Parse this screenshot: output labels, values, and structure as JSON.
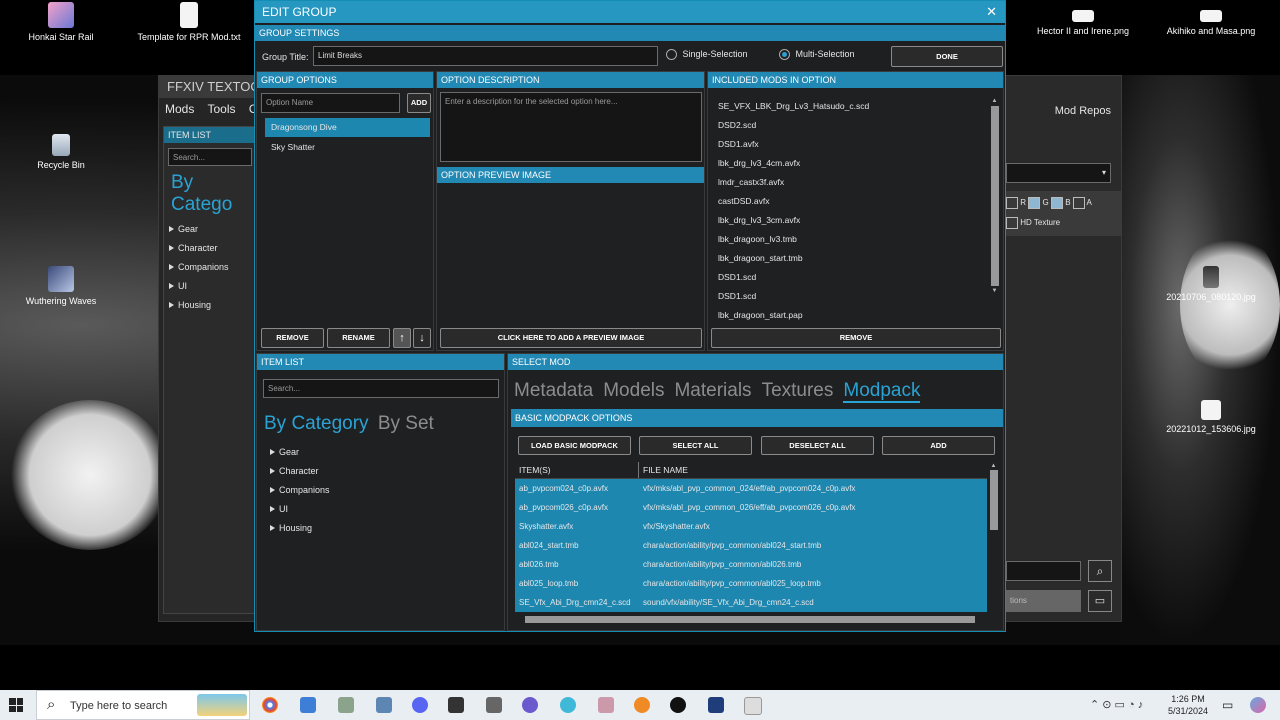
{
  "desktop": {
    "icons": [
      {
        "label": "Honkai Star Rail"
      },
      {
        "label": "Template for RPR Mod.txt"
      },
      {
        "label": "Hector II and Irene.png"
      },
      {
        "label": "Akihiko and Masa.png"
      },
      {
        "label": "Recycle Bin"
      },
      {
        "label": "Wuthering Waves"
      },
      {
        "label": "20210706_080120.jpg"
      },
      {
        "label": "20221012_153606.jpg"
      }
    ]
  },
  "bg_window": {
    "title": "FFXIV TEXTOOLS",
    "menu": [
      "Mods",
      "Tools",
      "Opt"
    ],
    "item_list_header": "ITEM LIST",
    "search_placeholder": "Search...",
    "by_category": "By Catego",
    "tree": [
      "Gear",
      "Character",
      "Companions",
      "UI",
      "Housing"
    ],
    "mod_repos": "Mod Repos",
    "channels": [
      "R",
      "G",
      "B",
      "A"
    ],
    "hd_texture": "HD Texture",
    "options_btn": "tions"
  },
  "dialog": {
    "title": "EDIT GROUP",
    "group_settings": {
      "header": "GROUP SETTINGS",
      "title_label": "Group Title:",
      "title_value": "Limit Breaks",
      "single_selection": "Single-Selection",
      "multi_selection": "Multi-Selection",
      "done": "DONE"
    },
    "group_options": {
      "header": "GROUP OPTIONS",
      "option_name_placeholder": "Option Name",
      "add": "ADD",
      "items": [
        "Dragonsong Dive",
        "Sky Shatter"
      ],
      "remove": "REMOVE",
      "rename": "RENAME"
    },
    "option_description": {
      "header": "OPTION DESCRIPTION",
      "placeholder": "Enter a description for the selected option here..."
    },
    "option_preview": {
      "header": "OPTION PREVIEW IMAGE",
      "add_button": "CLICK HERE TO ADD A PREVIEW IMAGE"
    },
    "included_mods": {
      "header": "INCLUDED MODS IN OPTION",
      "items": [
        "SE_VFX_LBK_Drg_Lv3_Hatsudo_c.scd",
        "DSD2.scd",
        "DSD1.avfx",
        "lbk_drg_lv3_4cm.avfx",
        "lmdr_castx3f.avfx",
        "castDSD.avfx",
        "lbk_drg_lv3_3cm.avfx",
        "lbk_dragoon_lv3.tmb",
        "lbk_dragoon_start.tmb",
        "DSD1.scd",
        "DSD1.scd",
        "lbk_dragoon_start.pap"
      ],
      "remove": "REMOVE"
    },
    "item_list": {
      "header": "ITEM LIST",
      "search_placeholder": "Search...",
      "by_category": "By Category",
      "by_set": "By Set",
      "tree": [
        "Gear",
        "Character",
        "Companions",
        "UI",
        "Housing"
      ]
    },
    "select_mod": {
      "header": "SELECT MOD",
      "tabs": [
        "Metadata",
        "Models",
        "Materials",
        "Textures",
        "Modpack"
      ],
      "active_tab": "Modpack",
      "basic_header": "BASIC MODPACK OPTIONS",
      "buttons": [
        "LOAD BASIC MODPACK",
        "SELECT ALL",
        "DESELECT ALL",
        "ADD"
      ],
      "col_items": "ITEM(S)",
      "col_file": "FILE NAME",
      "rows": [
        {
          "item": "ab_pvpcom024_c0p.avfx",
          "file": "vfx/mks/abl_pvp_common_024/eff/ab_pvpcom024_c0p.avfx"
        },
        {
          "item": "ab_pvpcom026_c0p.avfx",
          "file": "vfx/mks/abl_pvp_common_026/eff/ab_pvpcom026_c0p.avfx"
        },
        {
          "item": "Skyshatter.avfx",
          "file": "vfx/Skyshatter.avfx"
        },
        {
          "item": "abl024_start.tmb",
          "file": "chara/action/ability/pvp_common/abl024_start.tmb"
        },
        {
          "item": "abl026.tmb",
          "file": "chara/action/ability/pvp_common/abl026.tmb"
        },
        {
          "item": "abl025_loop.tmb",
          "file": "chara/action/ability/pvp_common/abl025_loop.tmb"
        },
        {
          "item": "SE_Vfx_Abi_Drg_cmn24_c.scd",
          "file": "sound/vfx/ability/SE_Vfx_Abi_Drg_cmn24_c.scd"
        }
      ]
    }
  },
  "taskbar": {
    "search_placeholder": "Type here to search",
    "time": "1:26 PM",
    "date": "5/31/2024"
  },
  "colors": {
    "accent": "#2697c1",
    "selected_row": "#1e87b0",
    "bg": "#1e1f20"
  }
}
